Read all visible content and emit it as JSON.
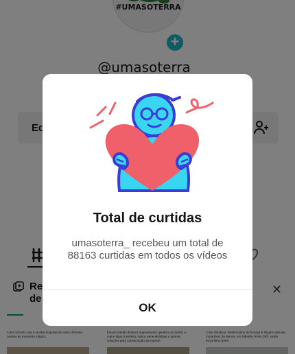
{
  "profile": {
    "avatar_text": "#UMASOTERRA",
    "username": "@umasoterra_",
    "edit_label": "Ed",
    "reposts_title": "Re de"
  },
  "videos": [
    {
      "caption": "Lobo cinzento usa e recebe resposta de toda a floresta. Assista ao momento mágico."
    },
    {
      "caption": "Estudo inédito destaca mapeamento genético do lontra, a maior água brasileira, indica vulnerabilidade e aponta soluções para conservação da espécie"
    },
    {
      "caption": "Crise climática: Redemoinho de fumaça e fuligem assusta moradores da Mooca, em Ribeirão Preto (SP), nesta terça-feira (10/9)"
    }
  ],
  "modal": {
    "title": "Total de curtidas",
    "body": "umasoterra_ recebeu um total de 88163 curtidas em todos os vídeos",
    "ok_label": "OK"
  },
  "colors": {
    "accent_teal": "#20b7c9",
    "heart_red": "#f0606b",
    "figure_cyan": "#38d6f0",
    "figure_outline": "#3b3bd6"
  }
}
